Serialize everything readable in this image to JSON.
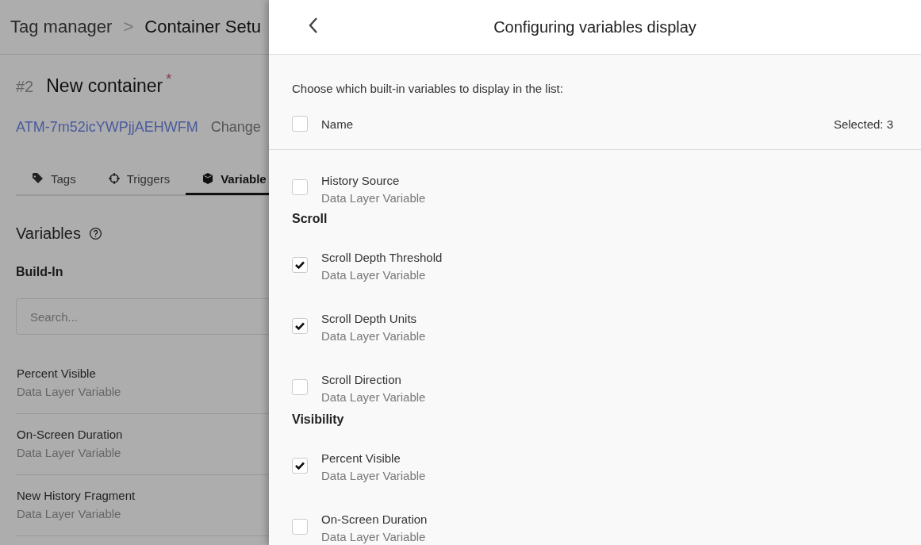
{
  "breadcrumb": {
    "parent": "Tag manager",
    "separator": ">",
    "current": "Container Setu"
  },
  "container": {
    "number": "#2",
    "name": "New container",
    "required_mark": "*",
    "id": "ATM-7m52icYWPjjAEHWFM",
    "action": "Change"
  },
  "tabs": [
    {
      "label": "Tags",
      "selected": false
    },
    {
      "label": "Triggers",
      "selected": false
    },
    {
      "label": "Variable",
      "selected": true
    }
  ],
  "variables": {
    "title": "Variables",
    "subtitle": "Build-In",
    "search": {
      "placeholder": "Search..."
    },
    "items": [
      {
        "name": "Percent Visible",
        "type": "Data Layer Variable"
      },
      {
        "name": "On-Screen Duration",
        "type": "Data Layer Variable"
      },
      {
        "name": "New History Fragment",
        "type": "Data Layer Variable"
      }
    ]
  },
  "panel": {
    "title": "Configuring variables display",
    "intro": "Choose which built-in variables to display in the list:",
    "header": {
      "label": "Name",
      "checked": false,
      "count": "Selected: 3"
    },
    "sections": [
      {
        "items": [
          {
            "name": "History Source",
            "type": "Data Layer Variable",
            "checked": false
          }
        ]
      },
      {
        "heading": "Scroll",
        "items": [
          {
            "name": "Scroll Depth Threshold",
            "type": "Data Layer Variable",
            "checked": true
          },
          {
            "name": "Scroll Depth Units",
            "type": "Data Layer Variable",
            "checked": true
          },
          {
            "name": "Scroll Direction",
            "type": "Data Layer Variable",
            "checked": false
          }
        ]
      },
      {
        "heading": "Visibility",
        "items": [
          {
            "name": "Percent Visible",
            "type": "Data Layer Variable",
            "checked": true
          },
          {
            "name": "On-Screen Duration",
            "type": "Data Layer Variable",
            "checked": false
          }
        ]
      }
    ]
  }
}
